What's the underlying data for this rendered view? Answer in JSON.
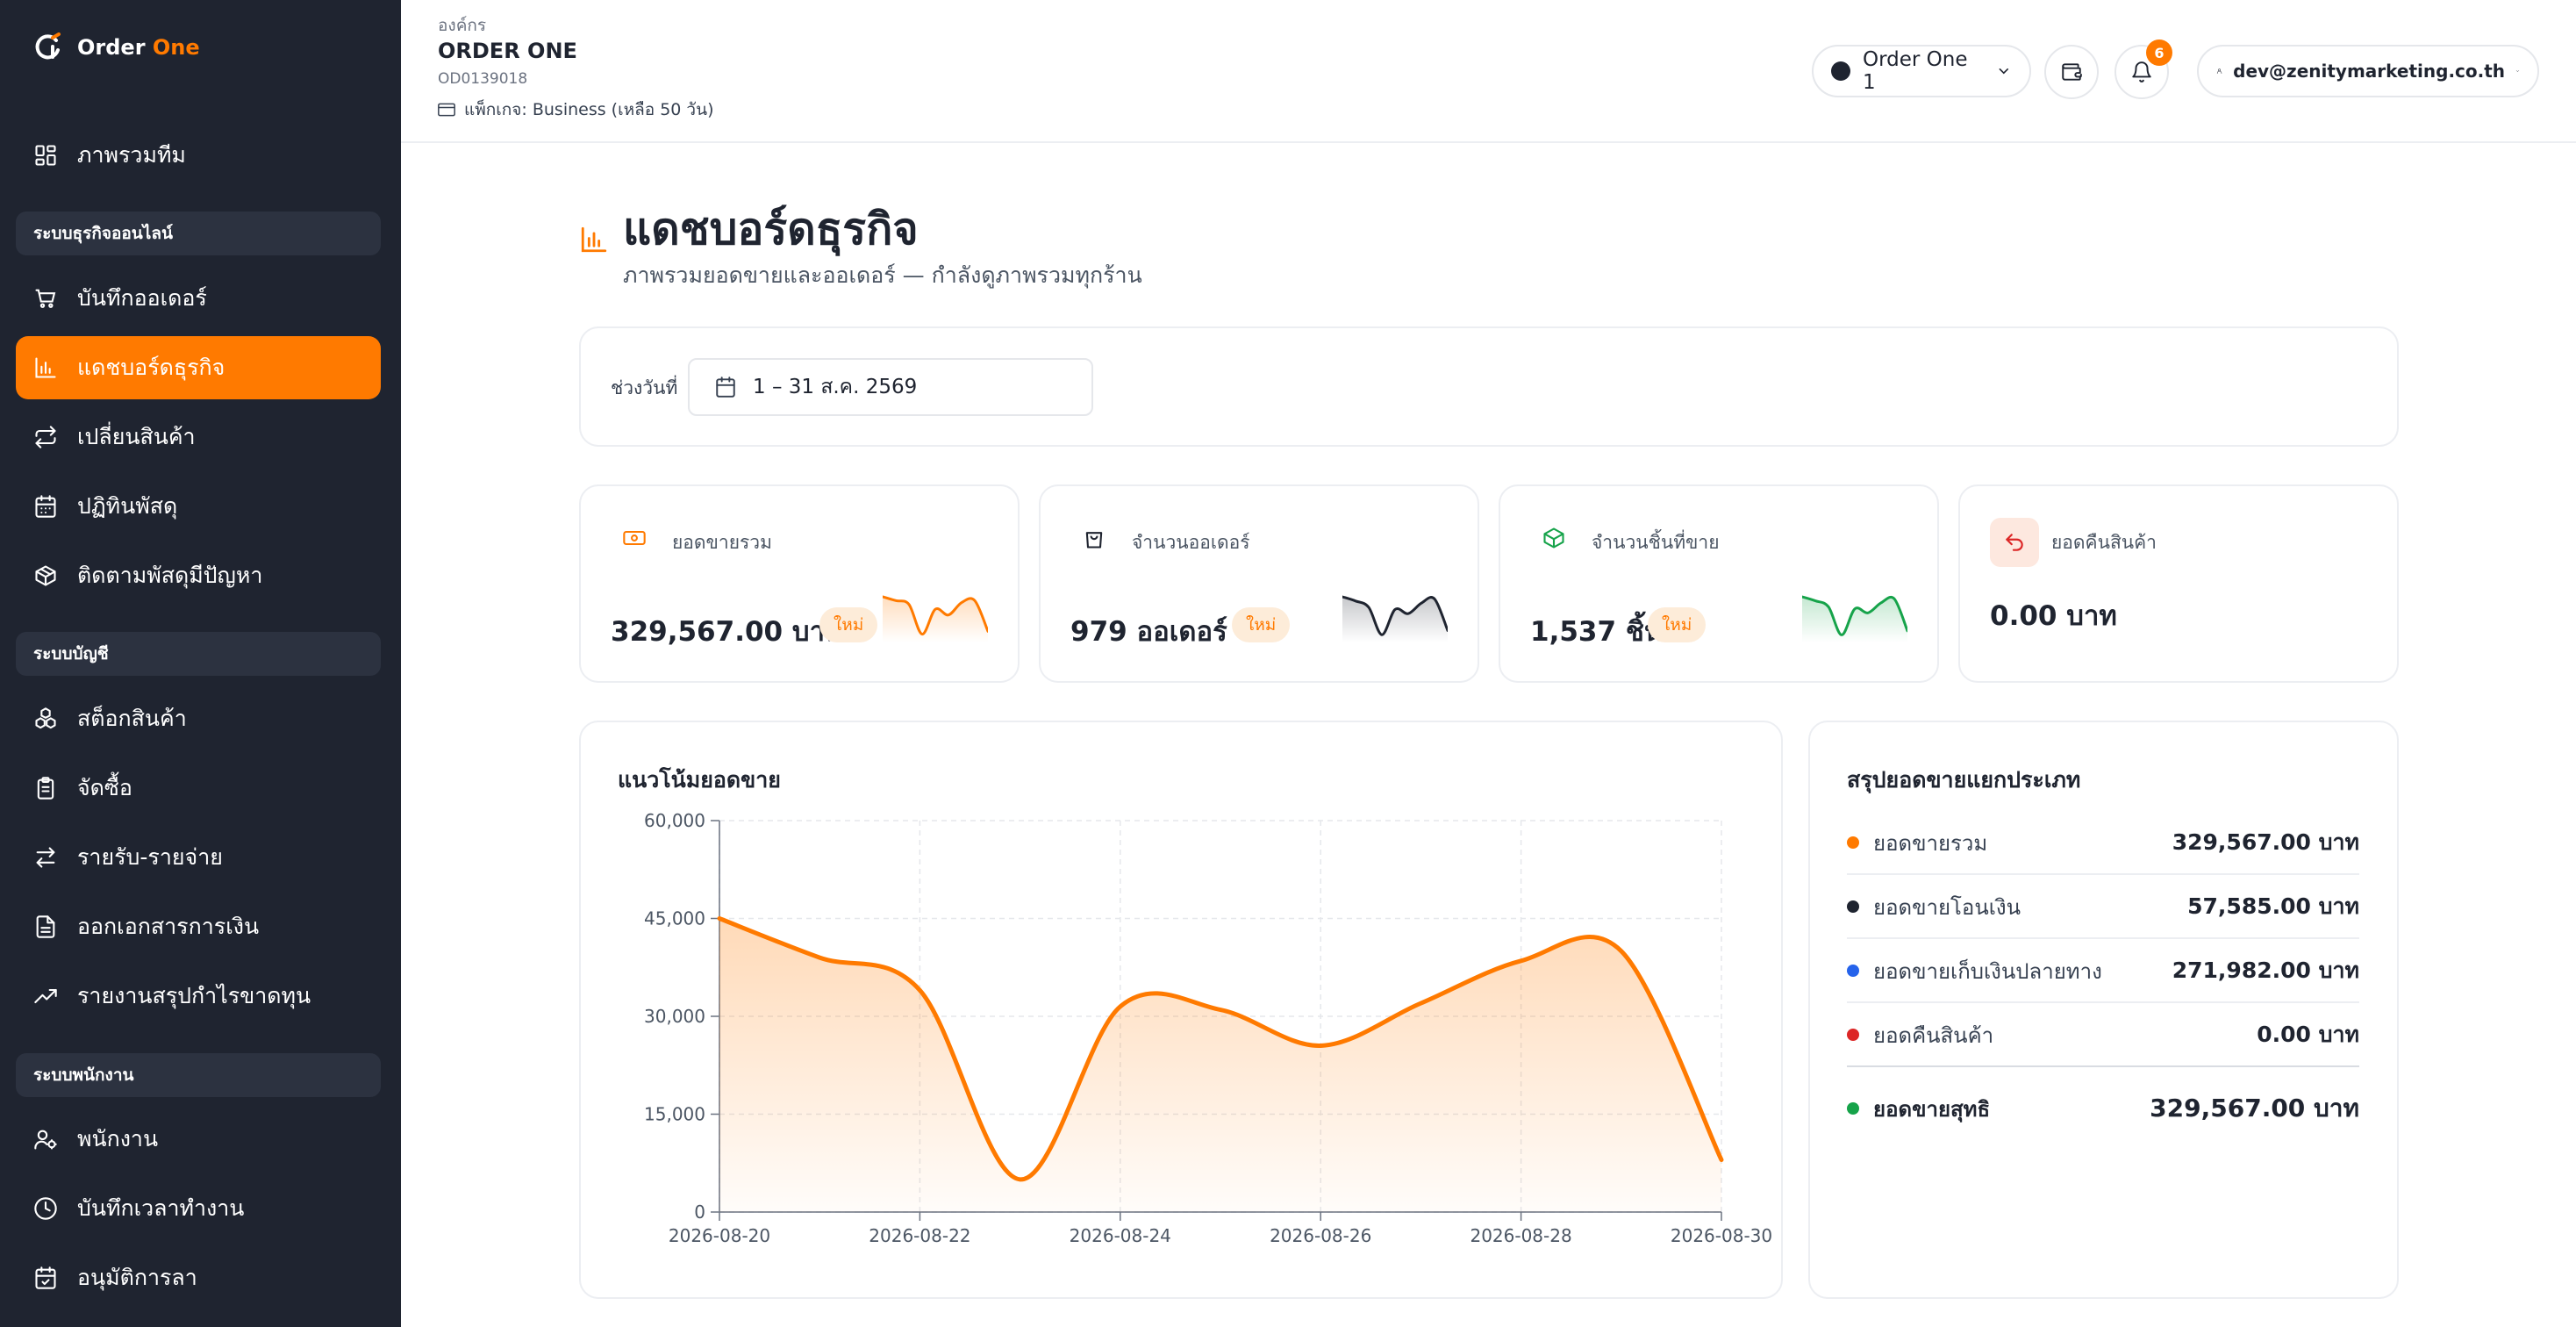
{
  "brand": {
    "name": "Order",
    "accent": "One"
  },
  "sidebar": {
    "top_item": {
      "label": "ภาพรวมทีม",
      "icon": "grid-icon"
    },
    "sections": [
      {
        "title": "ระบบธุรกิจออนไลน์",
        "items": [
          {
            "label": "บันทึกออเดอร์",
            "icon": "cart-icon"
          },
          {
            "label": "แดชบอร์ดธุรกิจ",
            "icon": "bar-chart-icon",
            "active": true
          },
          {
            "label": "เปลี่ยนสินค้า",
            "icon": "exchange-icon"
          },
          {
            "label": "ปฏิทินพัสดุ",
            "icon": "calendar-icon"
          },
          {
            "label": "ติดตามพัสดุมีปัญหา",
            "icon": "package-alert-icon"
          }
        ]
      },
      {
        "title": "ระบบบัญชี",
        "items": [
          {
            "label": "สต็อกสินค้า",
            "icon": "boxes-icon"
          },
          {
            "label": "จัดซื้อ",
            "icon": "clipboard-icon"
          },
          {
            "label": "รายรับ-รายจ่าย",
            "icon": "arrows-icon"
          },
          {
            "label": "ออกเอกสารการเงิน",
            "icon": "document-icon"
          },
          {
            "label": "รายงานสรุปกำไรขาดทุน",
            "icon": "trend-up-icon"
          }
        ]
      },
      {
        "title": "ระบบพนักงาน",
        "items": [
          {
            "label": "พนักงาน",
            "icon": "users-icon"
          },
          {
            "label": "บันทึกเวลาทำงาน",
            "icon": "clock-icon"
          },
          {
            "label": "อนุมัติการลา",
            "icon": "calendar-check-icon"
          }
        ]
      }
    ]
  },
  "header": {
    "org_label": "องค์กร",
    "org_name": "ORDER ONE",
    "org_id": "OD0139018",
    "package": "แพ็กเกจ: Business (เหลือ 50 วัน)",
    "store": "Order One 1",
    "notifications": "6",
    "user": "dev@zenitymarketing.co.th"
  },
  "page": {
    "title": "แดชบอร์ดธุรกิจ",
    "subtitle": "ภาพรวมยอดขายและออเดอร์ — กำลังดูภาพรวมทุกร้าน"
  },
  "filter": {
    "label": "ช่วงวันที่",
    "date_range": "1 – 31 ส.ค. 2569"
  },
  "stats": [
    {
      "label": "ยอดขายรวม",
      "value": "329,567.00 บาท",
      "badge": "ใหม่",
      "icon": "cash-icon",
      "spark_color": "#ff7a00",
      "spark": [
        44,
        40,
        36,
        5,
        31,
        25,
        38,
        40,
        8
      ]
    },
    {
      "label": "จำนวนออเดอร์",
      "value": "979 ออเดอร์",
      "badge": "ใหม่",
      "icon": "shopping-bag-icon",
      "spark_color": "#1f2430",
      "spark": [
        40,
        36,
        30,
        4,
        28,
        24,
        34,
        38,
        8
      ]
    },
    {
      "label": "จำนวนชิ้นที่ขาย",
      "value": "1,537 ชิ้น",
      "badge": "ใหม่",
      "icon": "cube-icon",
      "spark_color": "#16a34a",
      "spark": [
        42,
        38,
        32,
        4,
        30,
        26,
        36,
        40,
        8
      ]
    },
    {
      "label": "ยอดคืนสินค้า",
      "value": "0.00 บาท",
      "badge": "",
      "icon": "return-icon"
    }
  ],
  "trend": {
    "title": "แนวโน้มยอดขาย",
    "accent": "#ff7a00"
  },
  "chart_data": {
    "type": "area",
    "title": "แนวโน้มยอดขาย",
    "xlabel": "",
    "ylabel": "",
    "x": [
      "2026-08-20",
      "2026-08-21",
      "2026-08-22",
      "2026-08-23",
      "2026-08-24",
      "2026-08-25",
      "2026-08-26",
      "2026-08-27",
      "2026-08-28",
      "2026-08-29",
      "2026-08-30"
    ],
    "x_tick_labels": [
      "2026-08-20",
      "2026-08-22",
      "2026-08-24",
      "2026-08-26",
      "2026-08-28",
      "2026-08-30"
    ],
    "series": [
      {
        "values": [
          45000,
          39000,
          34000,
          5000,
          31500,
          31000,
          25500,
          32000,
          38500,
          40000,
          8000
        ]
      }
    ],
    "ylim": [
      0,
      60000
    ],
    "y_ticks": [
      0,
      15000,
      30000,
      45000,
      60000
    ],
    "y_tick_labels": [
      "0",
      "15,000",
      "30,000",
      "45,000",
      "60,000"
    ],
    "grid": true,
    "legend": "none"
  },
  "summary": {
    "title": "สรุปยอดขายแยกประเภท",
    "rows": [
      {
        "label": "ยอดขายรวม",
        "value": "329,567.00 บาท",
        "color": "#ff7a00"
      },
      {
        "label": "ยอดขายโอนเงิน",
        "value": "57,585.00 บาท",
        "color": "#1f2430"
      },
      {
        "label": "ยอดขายเก็บเงินปลายทาง",
        "value": "271,982.00 บาท",
        "color": "#2563eb"
      },
      {
        "label": "ยอดคืนสินค้า",
        "value": "0.00 บาท",
        "color": "#dc2626"
      }
    ],
    "total": {
      "label": "ยอดขายสุทธิ",
      "value": "329,567.00 บาท",
      "color": "#16a34a"
    }
  }
}
